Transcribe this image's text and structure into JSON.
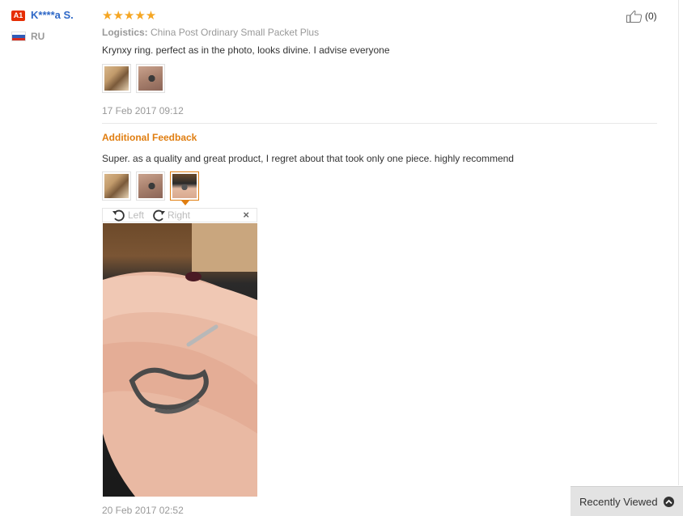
{
  "user": {
    "badge": "A1",
    "name": "K****a S.",
    "country": "RU"
  },
  "review": {
    "stars": "★★★★★",
    "rating": 5,
    "helpful_count": "(0)",
    "logistics_label": "Logistics:",
    "logistics_value": "China Post Ordinary Small Packet Plus",
    "text": "Krynxy ring. perfect as in the photo, looks divine. I advise everyone",
    "date": "17 Feb 2017 09:12"
  },
  "additional": {
    "title": "Additional Feedback",
    "text": "Super. as a quality and great product, I regret about that took only one piece. highly recommend",
    "date": "20 Feb 2017 02:52"
  },
  "viewer": {
    "rotate_left": "Left",
    "rotate_right": "Right",
    "close": "×"
  },
  "recently_viewed": {
    "label": "Recently Viewed"
  },
  "colors": {
    "accent": "#e07e11",
    "link": "#2e68c7",
    "star": "#f5a623",
    "badge": "#e62e04"
  }
}
